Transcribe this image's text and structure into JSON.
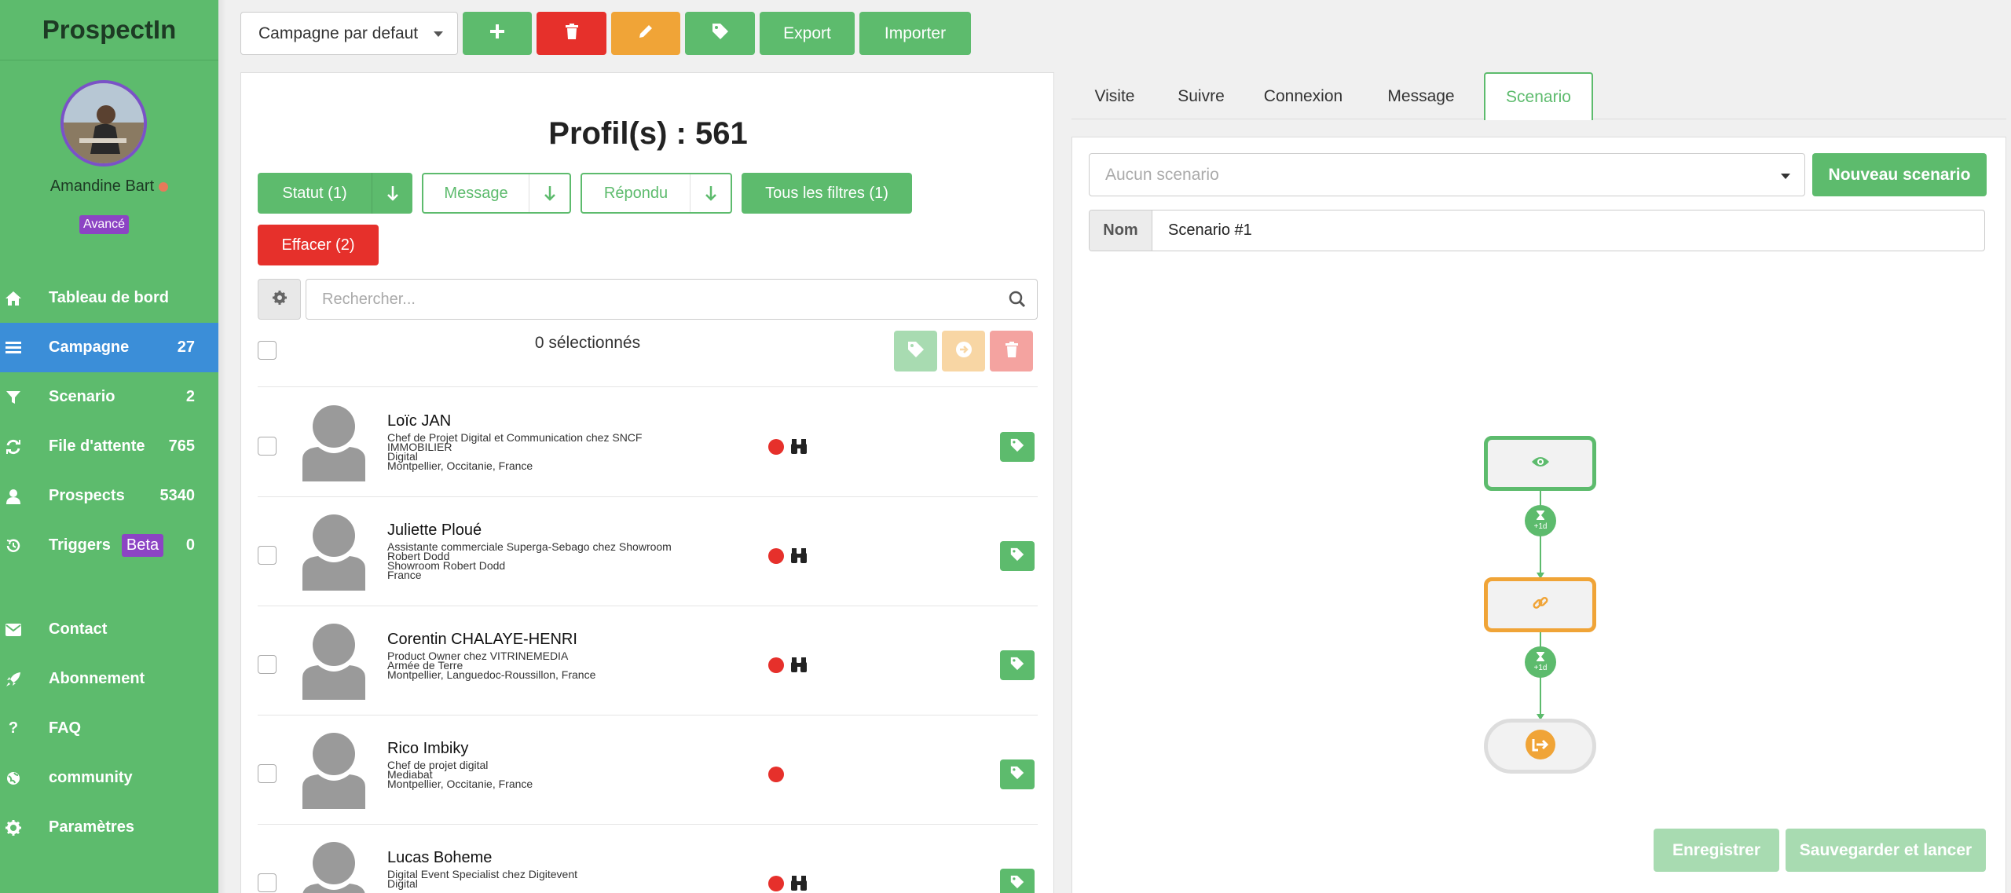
{
  "app": {
    "brand": "ProspectIn"
  },
  "user": {
    "name": "Amandine Bart",
    "level": "Avancé"
  },
  "nav": {
    "items": [
      {
        "label": "Tableau de bord",
        "count": "",
        "icon": "home-icon"
      },
      {
        "label": "Campagne",
        "count": "27",
        "icon": "list-icon"
      },
      {
        "label": "Scenario",
        "count": "2",
        "icon": "filter-icon"
      },
      {
        "label": "File d'attente",
        "count": "765",
        "icon": "refresh-icon"
      },
      {
        "label": "Prospects",
        "count": "5340",
        "icon": "user-icon"
      },
      {
        "label": "Triggers",
        "count": "0",
        "badge": "Beta",
        "icon": "history-icon"
      }
    ],
    "secondary": [
      {
        "label": "Contact",
        "icon": "envelope-icon"
      },
      {
        "label": "Abonnement",
        "icon": "rocket-icon"
      },
      {
        "label": "FAQ",
        "icon": "question-icon"
      },
      {
        "label": "community",
        "icon": "globe-icon"
      },
      {
        "label": "Paramètres",
        "icon": "gear-icon"
      }
    ]
  },
  "toolbar": {
    "campaign_select": "Campagne par defaut",
    "export_label": "Export",
    "import_label": "Importer"
  },
  "profiles": {
    "title": "Profil(s) : 561",
    "filters": {
      "statut": "Statut (1)",
      "message": "Message",
      "repondu": "Répondu",
      "all": "Tous les filtres (1)",
      "clear": "Effacer (2)"
    },
    "search_placeholder": "Rechercher...",
    "selected": "0 sélectionnés",
    "rows": [
      {
        "name": "Loïc JAN",
        "details": "Chef de Projet Digital et Communication chez SNCF\nIMMOBILIER\nDigital\nMontpellier, Occitanie, France",
        "status_color": "#e6302b",
        "viewed": true
      },
      {
        "name": "Juliette Ploué",
        "details": "Assistante commerciale Superga-Sebago chez Showroom\nRobert Dodd\nShowroom Robert Dodd\nFrance",
        "status_color": "#e6302b",
        "viewed": true
      },
      {
        "name": "Corentin CHALAYE-HENRI",
        "details": "Product Owner chez VITRINEMEDIA\nArmée de Terre\nMontpellier, Languedoc-Roussillon, France",
        "status_color": "#e6302b",
        "viewed": true
      },
      {
        "name": "Rico Imbiky",
        "details": "Chef de projet digital\nMediabat\nMontpellier, Occitanie, France",
        "status_color": "#e6302b",
        "viewed": false
      },
      {
        "name": "Lucas Boheme",
        "details": "Digital Event Specialist chez Digitevent\nDigital",
        "status_color": "#e6302b",
        "viewed": true
      }
    ]
  },
  "tabs": [
    {
      "label": "Visite"
    },
    {
      "label": "Suivre"
    },
    {
      "label": "Connexion"
    },
    {
      "label": "Message"
    },
    {
      "label": "Scenario",
      "active": true
    }
  ],
  "scenario": {
    "select_placeholder": "Aucun scenario",
    "new_label": "Nouveau scenario",
    "name_label": "Nom",
    "name_value": "Scenario #1",
    "delay_1": "+1d",
    "delay_2": "+1d",
    "save_label": "Enregistrer",
    "save_launch_label": "Sauvegarder et lancer"
  },
  "colors": {
    "accent": "#5dbb6d",
    "danger": "#e6302b",
    "warning": "#f0a437",
    "active_nav": "#3b8ed8",
    "badge": "#8c44c4"
  }
}
